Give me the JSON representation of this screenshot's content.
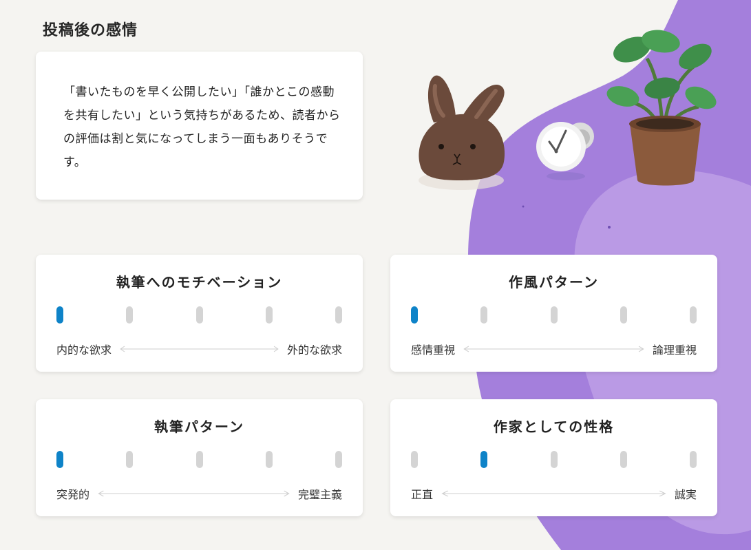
{
  "page": {
    "title": "投稿後の感情",
    "description": "「書いたものを早く公開したい」「誰かとこの感動を共有したい」という気持ちがあるため、読者からの評価は割と気になってしまう一面もありそうです。"
  },
  "traits": [
    {
      "title": "執筆へのモチベーション",
      "left_label": "内的な欲求",
      "right_label": "外的な欲求",
      "scale_steps": 5,
      "selected_step": 1
    },
    {
      "title": "作風パターン",
      "left_label": "感情重視",
      "right_label": "論理重視",
      "scale_steps": 5,
      "selected_step": 1
    },
    {
      "title": "執筆パターン",
      "left_label": "突発的",
      "right_label": "完璧主義",
      "scale_steps": 5,
      "selected_step": 1
    },
    {
      "title": "作家としての性格",
      "left_label": "正直",
      "right_label": "誠実",
      "scale_steps": 5,
      "selected_step": 2
    }
  ],
  "colors": {
    "accent": "#0e83c8",
    "inactive_step": "#d4d4d4",
    "blob_dark": "#a47fdc",
    "blob_light": "#bd9de6",
    "background": "#f5f4f1"
  },
  "illustration": {
    "icons": [
      "bunny-plush-icon",
      "alarm-clock-icon",
      "potted-plant-icon"
    ]
  }
}
